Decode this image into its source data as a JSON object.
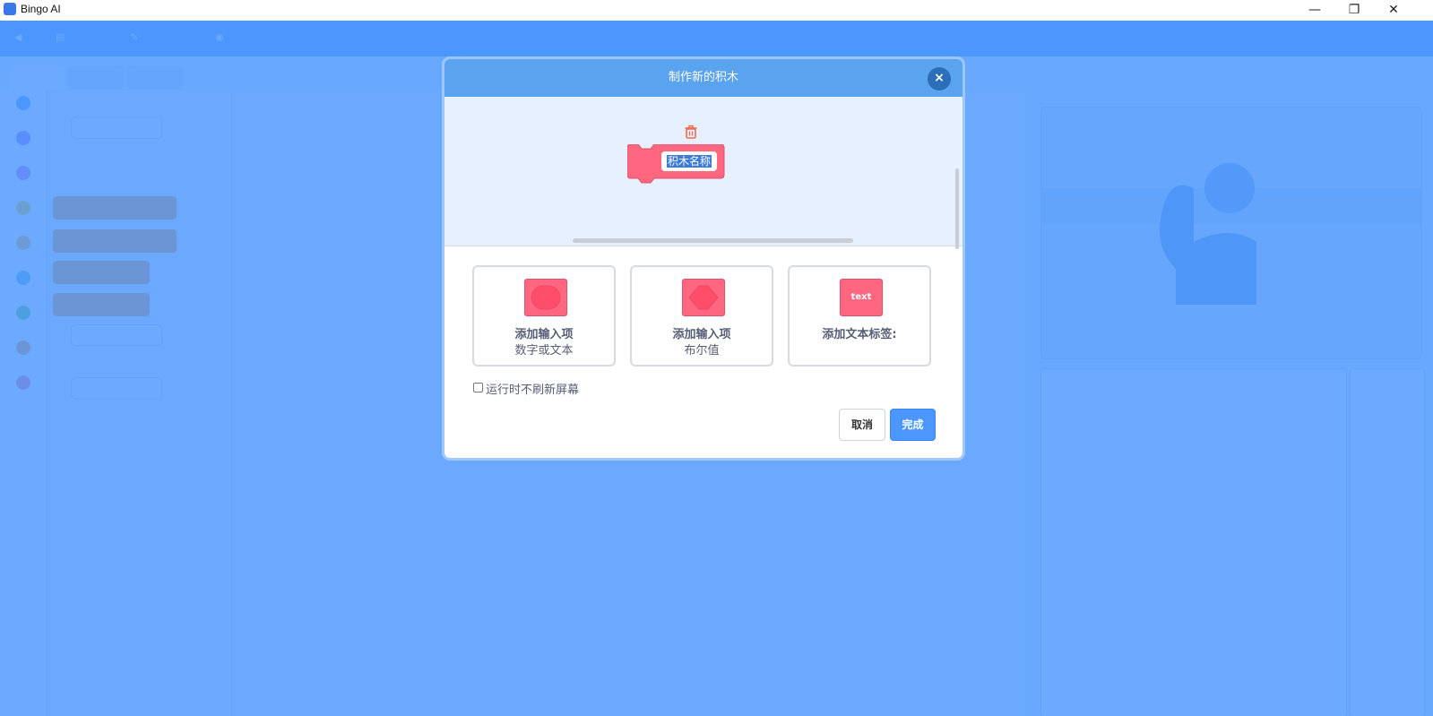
{
  "window": {
    "title": "Bingo AI",
    "controls": {
      "minimize": "—",
      "maximize": "❐",
      "close": "✕"
    }
  },
  "dialog": {
    "title": "制作新的积木",
    "close_label": "×",
    "block_name_value": "积木名称",
    "options": [
      {
        "title": "添加输入项",
        "subtitle": "数字或文本",
        "icon": "number-text-input-icon"
      },
      {
        "title": "添加输入项",
        "subtitle": "布尔值",
        "icon": "boolean-input-icon"
      },
      {
        "title": "添加文本标签:",
        "subtitle": "",
        "icon": "text-label-icon",
        "icon_text": "text"
      }
    ],
    "run_without_refresh_label": "运行时不刷新屏幕",
    "run_without_refresh_checked": false,
    "cancel_label": "取消",
    "ok_label": "完成"
  },
  "colors": {
    "header": "#5aa3ef",
    "block_pink": "#ff6680",
    "primary_button": "#4c97ff",
    "trash_icon": "#f06a4a"
  }
}
